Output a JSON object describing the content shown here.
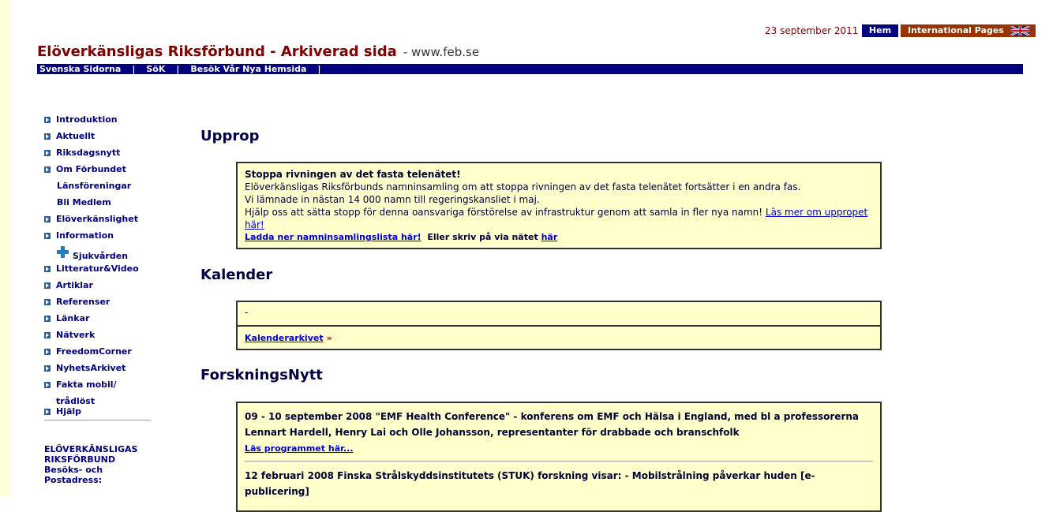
{
  "header": {
    "date": "23 september  2011",
    "hem_label": "Hem",
    "international_label": "International Pages",
    "site_title": "Elöverkänsligas Riksförbund - Arkiverad sida",
    "site_url": "- www.feb.se"
  },
  "topnav": {
    "items": [
      "Svenska Sidorna",
      "SöK",
      "Besök Vår Nya Hemsida"
    ],
    "separator": "|"
  },
  "sidebar": {
    "items": [
      {
        "label": "Introduktion",
        "bullet": true
      },
      {
        "label": "Aktuellt",
        "bullet": true
      },
      {
        "label": "Riksdagsnytt",
        "bullet": true
      },
      {
        "label": "Om Förbundet",
        "bullet": true
      },
      {
        "label": "Länsföreningar",
        "bullet": false
      },
      {
        "label": "Bli Medlem",
        "bullet": false
      },
      {
        "label": "Elöverkänslighet",
        "bullet": true
      },
      {
        "label": "Information",
        "bullet": true
      },
      {
        "label": "Sjukvården",
        "bullet": false
      },
      {
        "label": "Litteratur&Video",
        "bullet": true
      },
      {
        "label": "Artiklar",
        "bullet": true
      },
      {
        "label": "Referenser",
        "bullet": true
      },
      {
        "label": "Länkar",
        "bullet": true
      },
      {
        "label": "Nätverk",
        "bullet": true
      },
      {
        "label": "FreedomCorner",
        "bullet": true
      },
      {
        "label": "NyhetsArkivet",
        "bullet": true
      },
      {
        "label": "Fakta mobil/ trådlöst",
        "bullet": true
      },
      {
        "label": "Hjälp",
        "bullet": true
      }
    ],
    "address": "ELÖVERKÄNSLIGAS RIKSFÖRBUND",
    "address_line2": "Besöks- och Postadress:"
  },
  "uprop": {
    "heading": "Upprop",
    "title": "Stoppa rivningen av det fasta telenätet!",
    "line1": "Elöverkänsligas Riksförbunds namninsamling om att stoppa rivningen av det fasta telenätet fortsätter i en andra fas.",
    "line2": "Vi lämnade in nästan 14 000 namn till regeringskansliet i maj.",
    "line3": "Hjälp oss att sätta stopp för denna oansvariga förstörelse av infrastruktur genom att samla in fler nya namn!",
    "link_more": "Läs mer om uppropet här!",
    "download_link": "Ladda ner namninsamlingslista här!",
    "or_text": "Eller skriv på via nätet",
    "here_link": "här"
  },
  "kalender": {
    "heading": "Kalender",
    "entry": "-",
    "archive_link": "Kalenderarkivet",
    "archive_arrow": "»"
  },
  "forskning": {
    "heading": "ForskningsNytt",
    "items": [
      {
        "text": "09 - 10 september 2008 \"EMF Health Conference\" - konferens om EMF och Hälsa i England, med bl a professorerna Lennart Hardell, Henry Lai och Olle Johansson, representanter för drabbade och branschfolk",
        "link": "Läs programmet här..."
      },
      {
        "text": "12 februari 2008 Finska Strålskyddsinstitutets (STUK) forskning visar: - Mobilstrålning påverkar huden [e-publicering]"
      }
    ]
  }
}
